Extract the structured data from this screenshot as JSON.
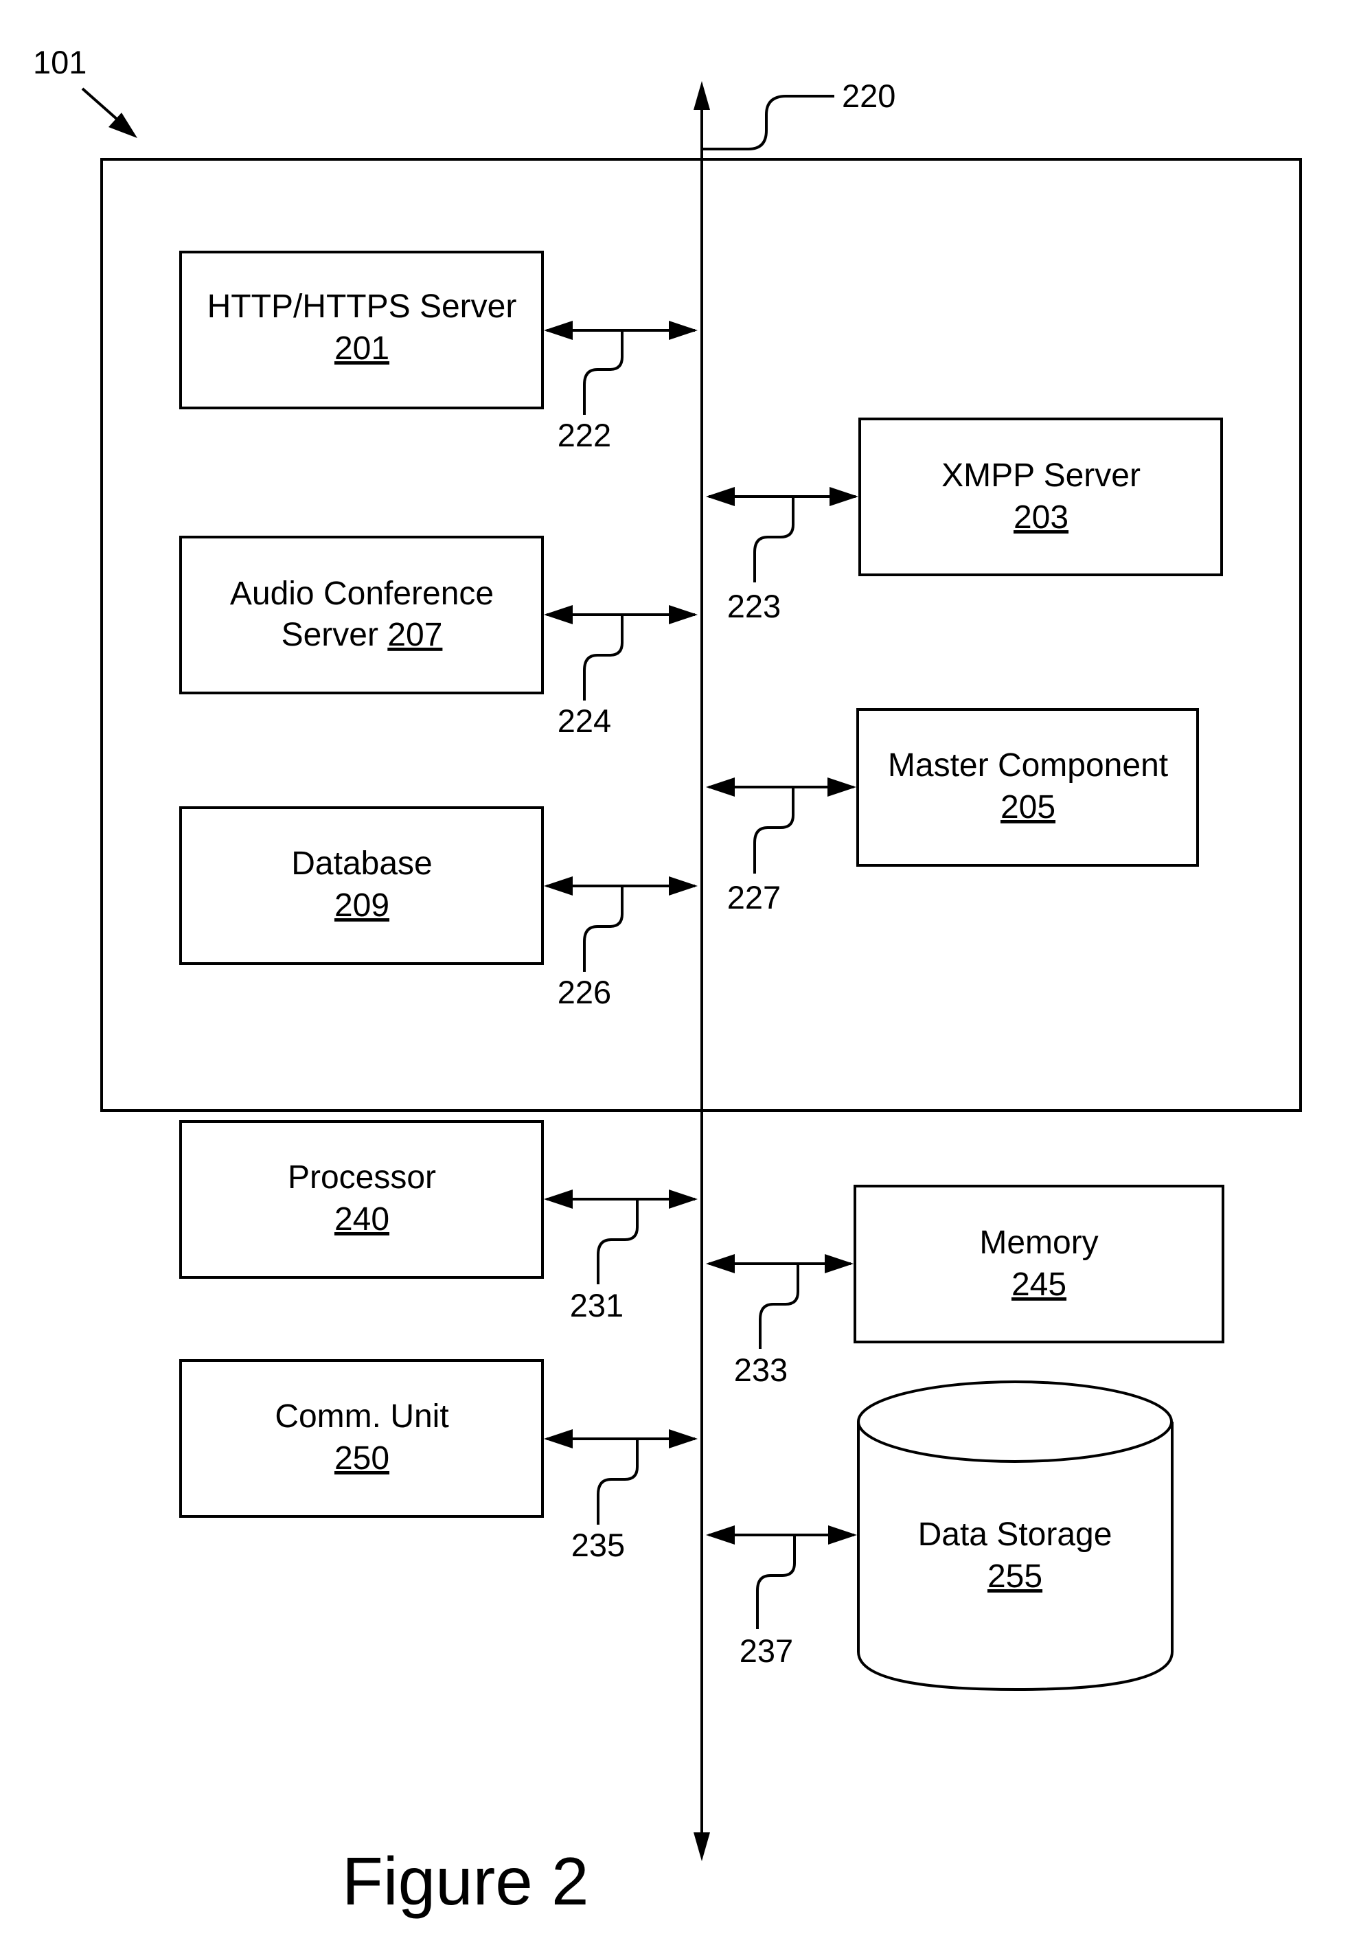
{
  "figure": {
    "title": "Figure 2",
    "system_ref": "101",
    "bus_ref": "220"
  },
  "components": [
    {
      "id": "http-server",
      "name": "HTTP/HTTPS Server",
      "ref": "201",
      "connector_ref": "222",
      "side": "left",
      "inside_system": true
    },
    {
      "id": "xmpp-server",
      "name": "XMPP Server",
      "ref": "203",
      "connector_ref": "223",
      "side": "right",
      "inside_system": true
    },
    {
      "id": "audio-conference-server",
      "name": "Audio Conference Server",
      "name_line1": "Audio Conference",
      "name_line2": "Server",
      "ref": "207",
      "connector_ref": "224",
      "side": "left",
      "inside_system": true
    },
    {
      "id": "master-component",
      "name": "Master Component",
      "ref": "205",
      "connector_ref": "227",
      "side": "right",
      "inside_system": true
    },
    {
      "id": "database",
      "name": "Database",
      "ref": "209",
      "connector_ref": "226",
      "side": "left",
      "inside_system": true
    },
    {
      "id": "processor",
      "name": "Processor",
      "ref": "240",
      "connector_ref": "231",
      "side": "left",
      "inside_system": false
    },
    {
      "id": "memory",
      "name": "Memory",
      "ref": "245",
      "connector_ref": "233",
      "side": "right",
      "inside_system": false
    },
    {
      "id": "comm-unit",
      "name": "Comm. Unit",
      "ref": "250",
      "connector_ref": "235",
      "side": "left",
      "inside_system": false
    },
    {
      "id": "data-storage",
      "name": "Data Storage",
      "ref": "255",
      "connector_ref": "237",
      "side": "right",
      "inside_system": false,
      "shape": "cylinder"
    }
  ]
}
